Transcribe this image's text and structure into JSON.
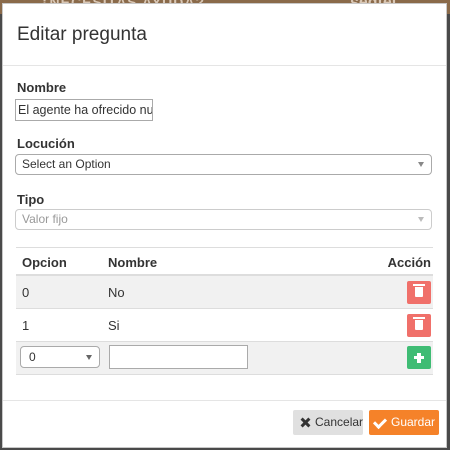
{
  "backdrop": {
    "left_text": "¿NECESITAS AYUDA?",
    "right_text": "sedtel"
  },
  "modal": {
    "title": "Editar pregunta",
    "nombre": {
      "label": "Nombre",
      "value": "El agente ha ofrecido nu"
    },
    "locucion": {
      "label": "Locución",
      "value": "Select an Option"
    },
    "tipo": {
      "label": "Tipo",
      "value": "Valor fijo"
    },
    "table": {
      "headers": {
        "opcion": "Opcion",
        "nombre": "Nombre",
        "accion": "Acción"
      },
      "rows": [
        {
          "opcion": "0",
          "nombre": "No"
        },
        {
          "opcion": "1",
          "nombre": "Si"
        }
      ],
      "new_row": {
        "opcion_value": "0",
        "nombre_value": ""
      }
    },
    "footer": {
      "cancel_label": "Cancelar",
      "save_label": "Guardar"
    }
  },
  "colors": {
    "delete": "#f0706a",
    "add": "#3fbc74",
    "save": "#f58229",
    "cancel": "#e0e0e0"
  },
  "icons": [
    "trash-icon",
    "plus-icon",
    "close-icon",
    "check-icon",
    "caret-down-icon"
  ]
}
